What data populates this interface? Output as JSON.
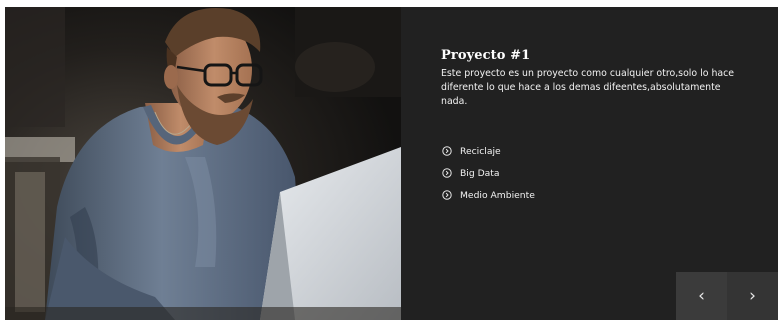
{
  "project": {
    "title": "Proyecto #1",
    "description": "Este proyecto es un proyecto como cualquier otro,solo lo hace diferente lo que hace a los demas difeentes,absolutamente nada.",
    "features": [
      {
        "label": "Reciclaje",
        "icon": "circle-chevron-right-icon"
      },
      {
        "label": "Big Data",
        "icon": "circle-chevron-right-icon"
      },
      {
        "label": "Medio Ambiente",
        "icon": "circle-chevron-right-icon"
      }
    ]
  },
  "navigation": {
    "prev_label": "‹",
    "next_label": "›"
  },
  "colors": {
    "panel_background": "#212121",
    "nav_background": "#3a3a3a",
    "text": "#ffffff"
  }
}
